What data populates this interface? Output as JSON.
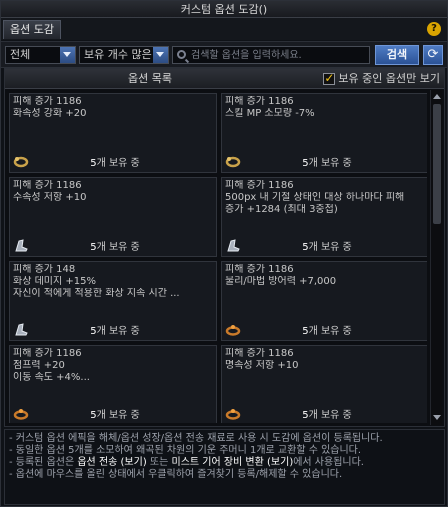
{
  "window": {
    "title": "커스텀 옵션 도감()"
  },
  "tabs": [
    {
      "label": "옵션 도감"
    }
  ],
  "filters": {
    "category": "전체",
    "sort": "보유 개수 많은 순",
    "search_placeholder": "검색할 옵션을 입력하세요.",
    "search_button": "검색"
  },
  "list": {
    "title": "옵션 목록",
    "owned_only_label": "보유 중인 옵션만 보기",
    "owned_only_checked": true
  },
  "cards": [
    {
      "lines": [
        "피해 증가 1186",
        "화속성 강화 +20"
      ],
      "count": "5",
      "suffix": "개 보유 중",
      "icon": "bracelet-icon"
    },
    {
      "lines": [
        "피해 증가 1186",
        "스킬 MP 소모량 -7%"
      ],
      "count": "5",
      "suffix": "개 보유 중",
      "icon": "bracelet-icon"
    },
    {
      "lines": [
        "피해 증가 1186",
        "수속성 저항 +10"
      ],
      "count": "5",
      "suffix": "개 보유 중",
      "icon": "boot-icon"
    },
    {
      "lines": [
        "피해 증가 1186",
        "500px 내 기절 상태인 대상 하나마다 피해",
        "증가 +1284 (최대 3중첩)"
      ],
      "count": "5",
      "suffix": "개 보유 중",
      "icon": "boot-icon"
    },
    {
      "lines": [
        "피해 증가 148",
        "화상 데미지 +15%",
        "자신이 적에게 적용한 화상 지속 시간 ..."
      ],
      "count": "5",
      "suffix": "개 보유 중",
      "icon": "boot-icon"
    },
    {
      "lines": [
        "피해 증가 1186",
        "물리/마법 방어력 +7,000"
      ],
      "count": "5",
      "suffix": "개 보유 중",
      "icon": "ring-icon"
    },
    {
      "lines": [
        "피해 증가 1186",
        "점프력 +20",
        "이동 속도 +4%..."
      ],
      "count": "5",
      "suffix": "개 보유 중",
      "icon": "ring-icon"
    },
    {
      "lines": [
        "피해 증가 1186",
        "명속성 저항 +10"
      ],
      "count": "5",
      "suffix": "개 보유 중",
      "icon": "ring-icon"
    }
  ],
  "notes": [
    [
      {
        "t": "- 커스텀 옵션 에픽을 해체/옵션 성장/옵션 전송 재료로 사용 시 도감에 옵션이 등록됩니다.",
        "hl": false
      }
    ],
    [
      {
        "t": "- 동일한 옵션 5개를 소모하여 왜곡된 차원의 기운 주머니 1개로 교환할 수 있습니다.",
        "hl": false
      }
    ],
    [
      {
        "t": "- 등록된 옵션은 ",
        "hl": false
      },
      {
        "t": "옵션 전송 (보기)",
        "hl": true
      },
      {
        "t": " 또는 ",
        "hl": false
      },
      {
        "t": "미스트 기어 장비 변환 (보기)",
        "hl": true
      },
      {
        "t": "에서 사용됩니다.",
        "hl": false
      }
    ],
    [
      {
        "t": "- 옵션에 마우스를 올린 상태에서 우클릭하여 즐겨찾기 등록/해제할 수 있습니다.",
        "hl": false
      }
    ]
  ],
  "colors": {
    "accent": "#f0c21a",
    "button": "#3a64ad",
    "card_bg": "#16191f"
  }
}
